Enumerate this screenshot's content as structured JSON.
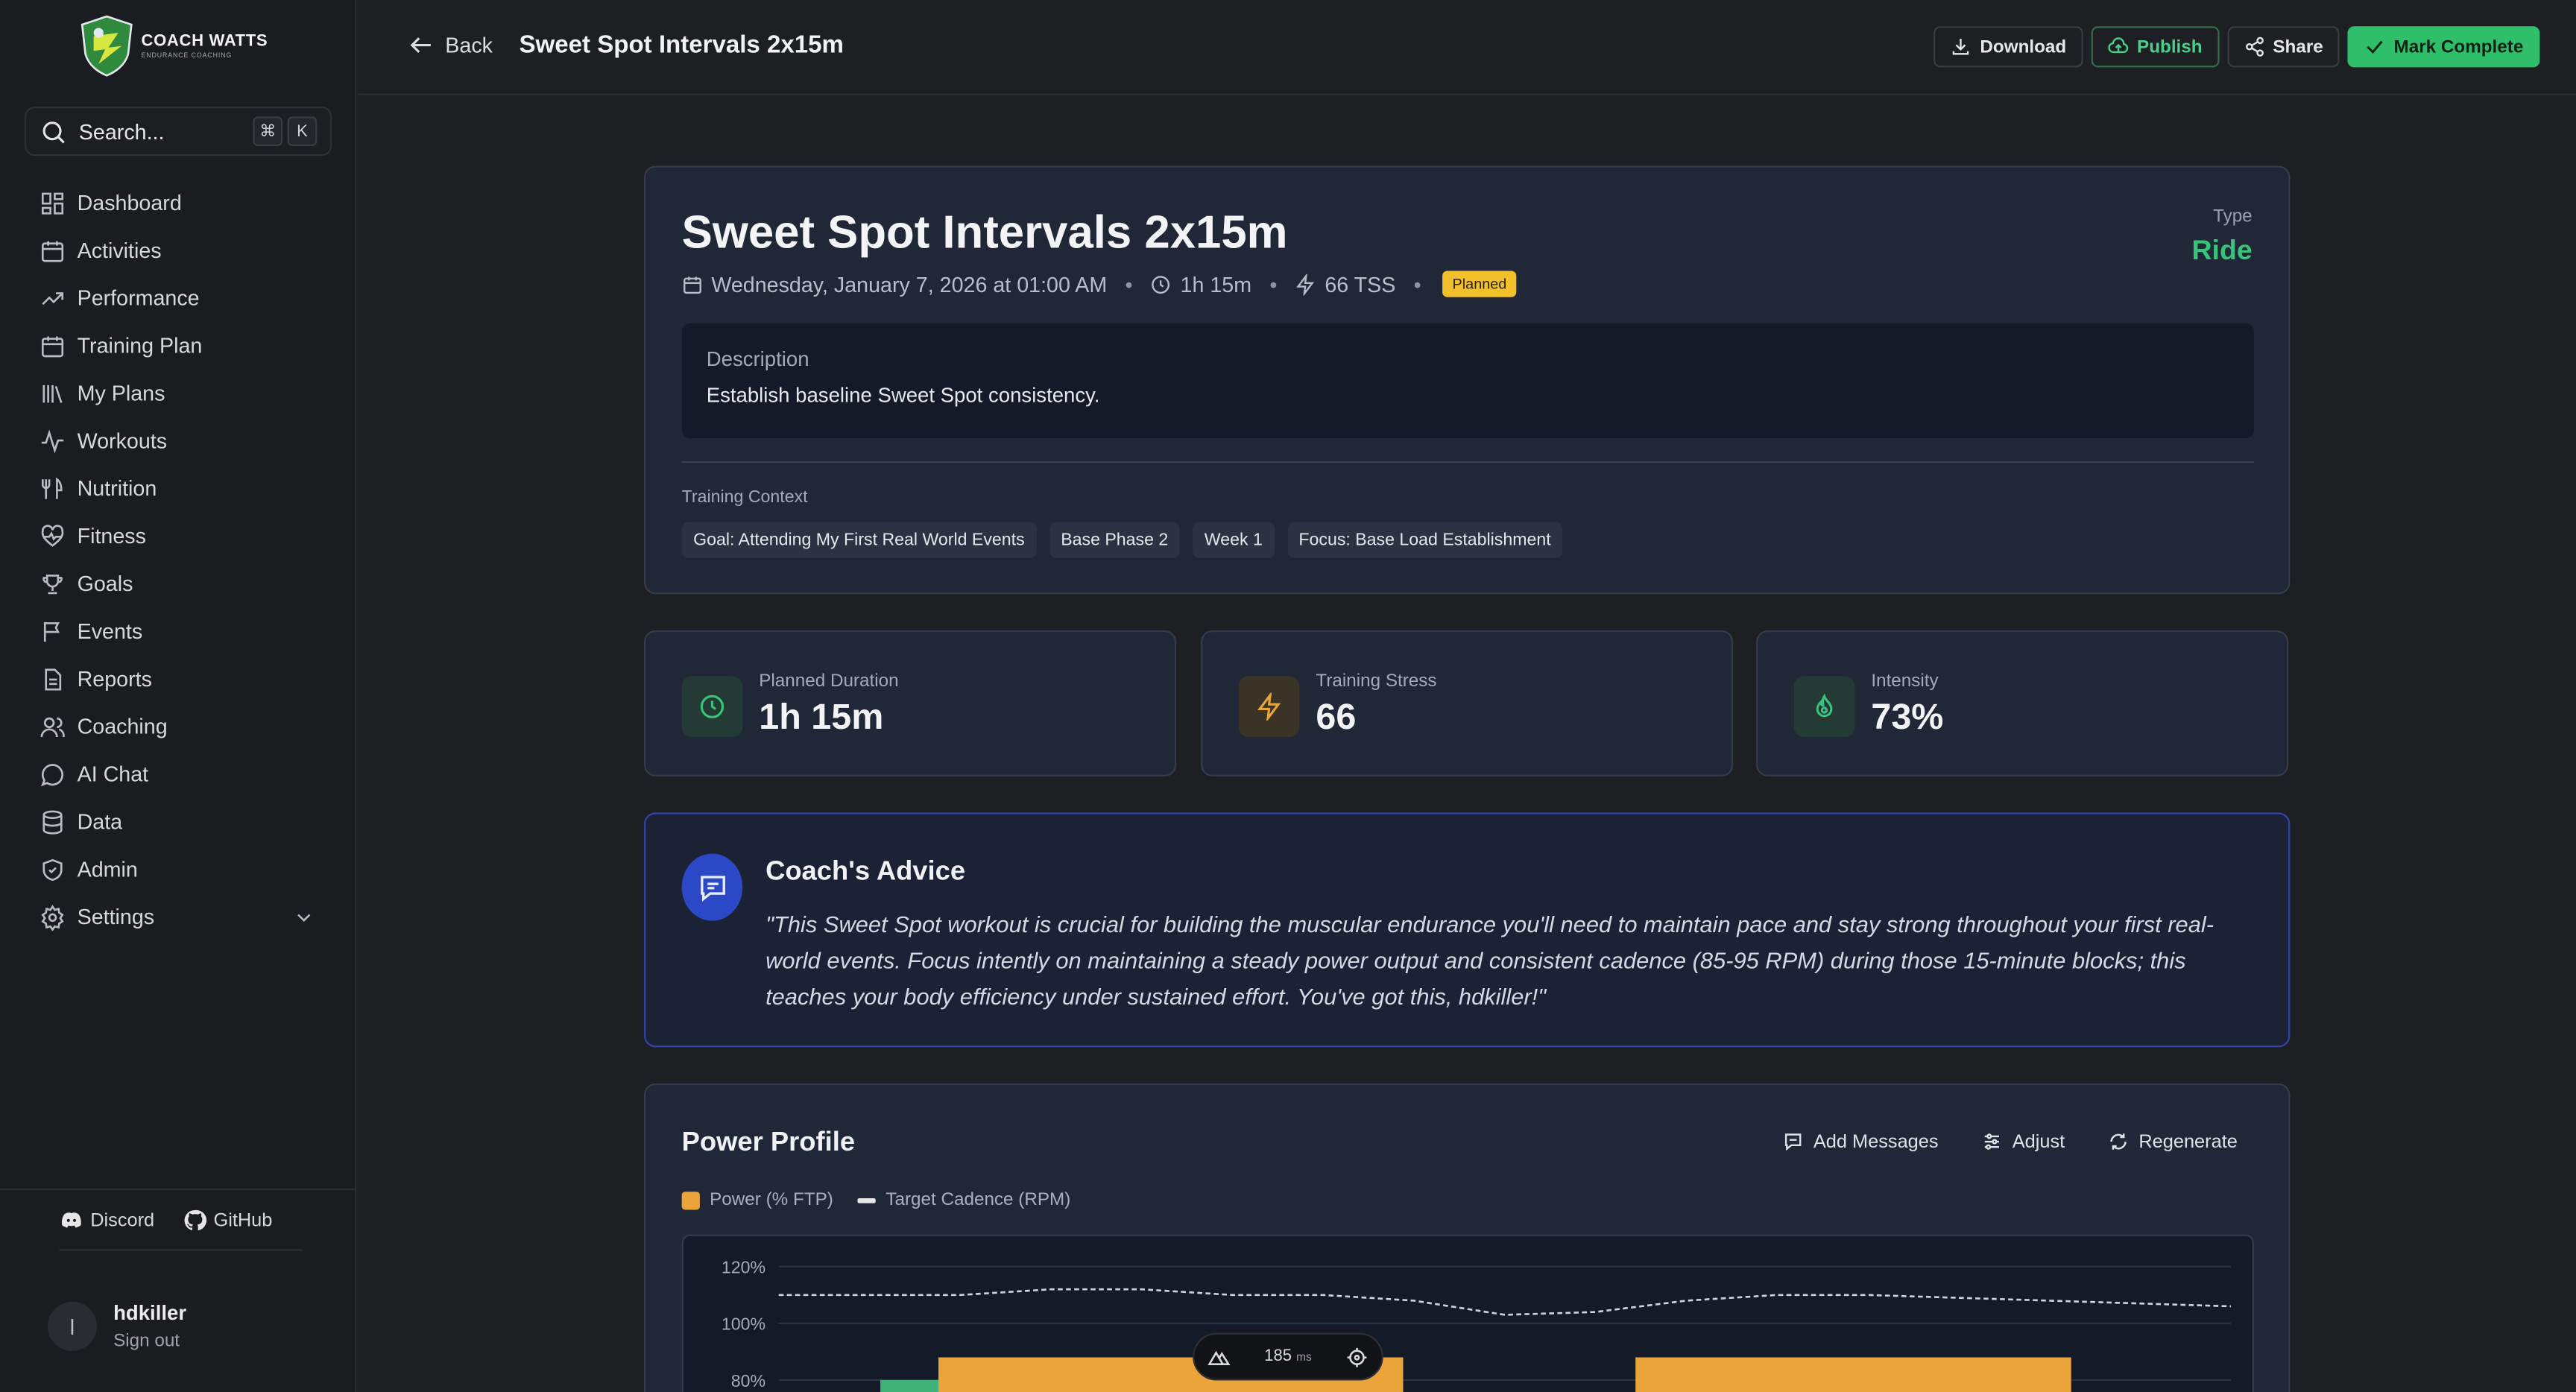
{
  "brand": {
    "name": "COACH WATTS",
    "tagline": "ENDURANCE COACHING"
  },
  "search": {
    "placeholder": "Search...",
    "kbd_mod": "⌘",
    "kbd_key": "K"
  },
  "nav": [
    {
      "label": "Dashboard",
      "icon": "dashboard-icon"
    },
    {
      "label": "Activities",
      "icon": "calendar-icon"
    },
    {
      "label": "Performance",
      "icon": "trend-icon"
    },
    {
      "label": "Training Plan",
      "icon": "calendar-icon"
    },
    {
      "label": "My Plans",
      "icon": "library-icon"
    },
    {
      "label": "Workouts",
      "icon": "activity-icon"
    },
    {
      "label": "Nutrition",
      "icon": "utensils-icon"
    },
    {
      "label": "Fitness",
      "icon": "heart-pulse-icon"
    },
    {
      "label": "Goals",
      "icon": "trophy-icon"
    },
    {
      "label": "Events",
      "icon": "flag-icon"
    },
    {
      "label": "Reports",
      "icon": "file-icon"
    },
    {
      "label": "Coaching",
      "icon": "users-icon"
    },
    {
      "label": "AI Chat",
      "icon": "chat-icon"
    },
    {
      "label": "Data",
      "icon": "database-icon"
    },
    {
      "label": "Admin",
      "icon": "shield-icon"
    },
    {
      "label": "Settings",
      "icon": "gear-icon"
    }
  ],
  "footer": {
    "discord": "Discord",
    "github": "GitHub"
  },
  "user": {
    "initial": "l",
    "name": "hdkiller",
    "signout": "Sign out"
  },
  "topbar": {
    "back": "Back",
    "title": "Sweet Spot Intervals 2x15m",
    "download": "Download",
    "publish": "Publish",
    "share": "Share",
    "complete": "Mark Complete"
  },
  "workout": {
    "title": "Sweet Spot Intervals 2x15m",
    "date": "Wednesday, January 7, 2026 at 01:00 AM",
    "duration": "1h 15m",
    "tss": "66 TSS",
    "status": "Planned",
    "type_label": "Type",
    "type_value": "Ride",
    "description_label": "Description",
    "description": "Establish baseline Sweet Spot consistency.",
    "context_label": "Training Context",
    "tags": [
      "Goal: Attending My First Real World Events",
      "Base Phase 2",
      "Week 1",
      "Focus: Base Load Establishment"
    ]
  },
  "stats": [
    {
      "label": "Planned Duration",
      "value": "1h 15m",
      "icon": "clock-icon",
      "color": "#37c47a"
    },
    {
      "label": "Training Stress",
      "value": "66",
      "icon": "bolt-icon",
      "color": "#eba43a"
    },
    {
      "label": "Intensity",
      "value": "73%",
      "icon": "flame-icon",
      "color": "#37c47a"
    }
  ],
  "advice": {
    "title": "Coach's Advice",
    "text": "\"This Sweet Spot workout is crucial for building the muscular endurance you'll need to maintain pace and stay strong throughout your first real-world events. Focus intently on maintaining a steady power output and consistent cadence (85-95 RPM) during those 15-minute blocks; this teaches your body efficiency under sustained effort. You've got this, hdkiller!\""
  },
  "power": {
    "title": "Power Profile",
    "add_messages": "Add Messages",
    "adjust": "Adjust",
    "regenerate": "Regenerate",
    "legend_power": "Power (% FTP)",
    "legend_cadence": "Target Cadence (RPM)"
  },
  "chart_data": {
    "type": "area",
    "title": "Power Profile",
    "yticks": [
      "120%",
      "100%",
      "80%"
    ],
    "ylim": [
      70,
      125
    ],
    "series": [
      {
        "name": "Power (% FTP)",
        "color": "#eba43a",
        "segments": [
          {
            "start": 0.07,
            "end": 0.11,
            "value": 80,
            "color": "#3fb27a"
          },
          {
            "start": 0.11,
            "end": 0.43,
            "value": 88,
            "color": "#eba43a"
          },
          {
            "start": 0.43,
            "end": 0.59,
            "value": 60,
            "color": "#141a27"
          },
          {
            "start": 0.59,
            "end": 0.89,
            "value": 88,
            "color": "#eba43a"
          }
        ]
      },
      {
        "name": "Target Cadence (RPM)",
        "color": "#cfd3da",
        "points": [
          110,
          110,
          110,
          112,
          112,
          110,
          110,
          108,
          103,
          104,
          108,
          110,
          110,
          109,
          108,
          107,
          106
        ]
      }
    ]
  },
  "perf": {
    "value": "185",
    "unit": "ms"
  }
}
